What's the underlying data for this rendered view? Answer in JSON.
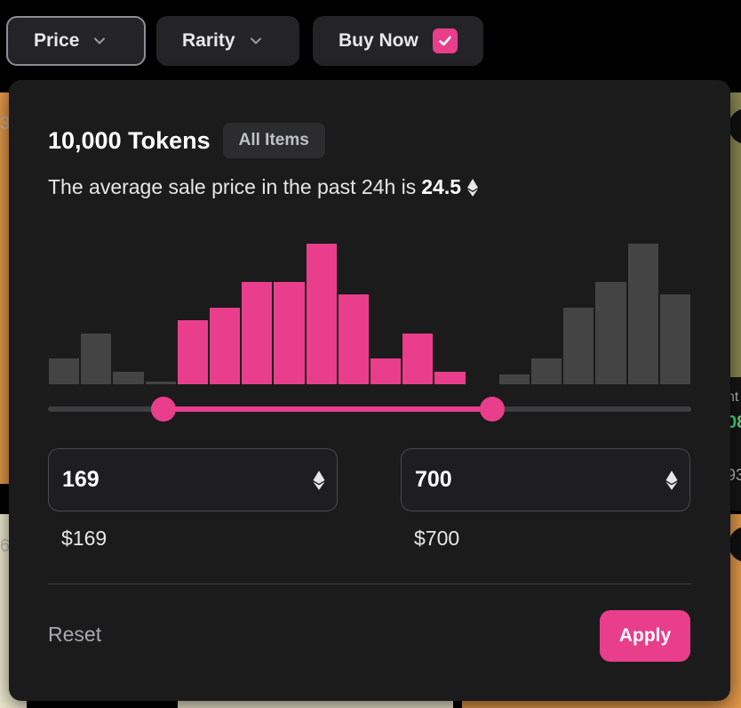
{
  "filters": {
    "price_label": "Price",
    "rarity_label": "Rarity",
    "buy_now_label": "Buy Now",
    "buy_now_checked": true
  },
  "panel": {
    "title": "10,000 Tokens",
    "tag": "All Items",
    "avg_prefix": "The average sale price in the past 24h is",
    "avg_value": "24.5",
    "histogram": {
      "bars": [
        {
          "value": 20,
          "selected": false
        },
        {
          "value": 40,
          "selected": false
        },
        {
          "value": 10,
          "selected": false
        },
        {
          "value": 2,
          "selected": false
        },
        {
          "value": 50,
          "selected": true
        },
        {
          "value": 60,
          "selected": true
        },
        {
          "value": 80,
          "selected": true
        },
        {
          "value": 80,
          "selected": true
        },
        {
          "value": 110,
          "selected": true
        },
        {
          "value": 70,
          "selected": true
        },
        {
          "value": 20,
          "selected": true
        },
        {
          "value": 40,
          "selected": true
        },
        {
          "value": 10,
          "selected": true
        },
        {
          "value": 0,
          "selected": false
        },
        {
          "value": 8,
          "selected": false
        },
        {
          "value": 20,
          "selected": false
        },
        {
          "value": 60,
          "selected": false
        },
        {
          "value": 80,
          "selected": false
        },
        {
          "value": 110,
          "selected": false
        },
        {
          "value": 70,
          "selected": false
        }
      ],
      "max": 110
    },
    "range": {
      "min_fraction": 0.18,
      "max_fraction": 0.69
    },
    "min_value": "169",
    "max_value": "700",
    "min_usd": "$169",
    "max_usd": "$700",
    "reset_label": "Reset",
    "apply_label": "Apply"
  },
  "background": {
    "peek_left_top": "3",
    "peek_left_bottom": "6",
    "peek_right_text": "nt",
    "peek_right_green": "08",
    "peek_right_num": "93",
    "peek_circle_top": "-",
    "peek_circle_bottom": "-"
  },
  "colors": {
    "accent": "#e83e8c",
    "panel": "#1b1b1c",
    "bar_inactive": "#444444"
  }
}
